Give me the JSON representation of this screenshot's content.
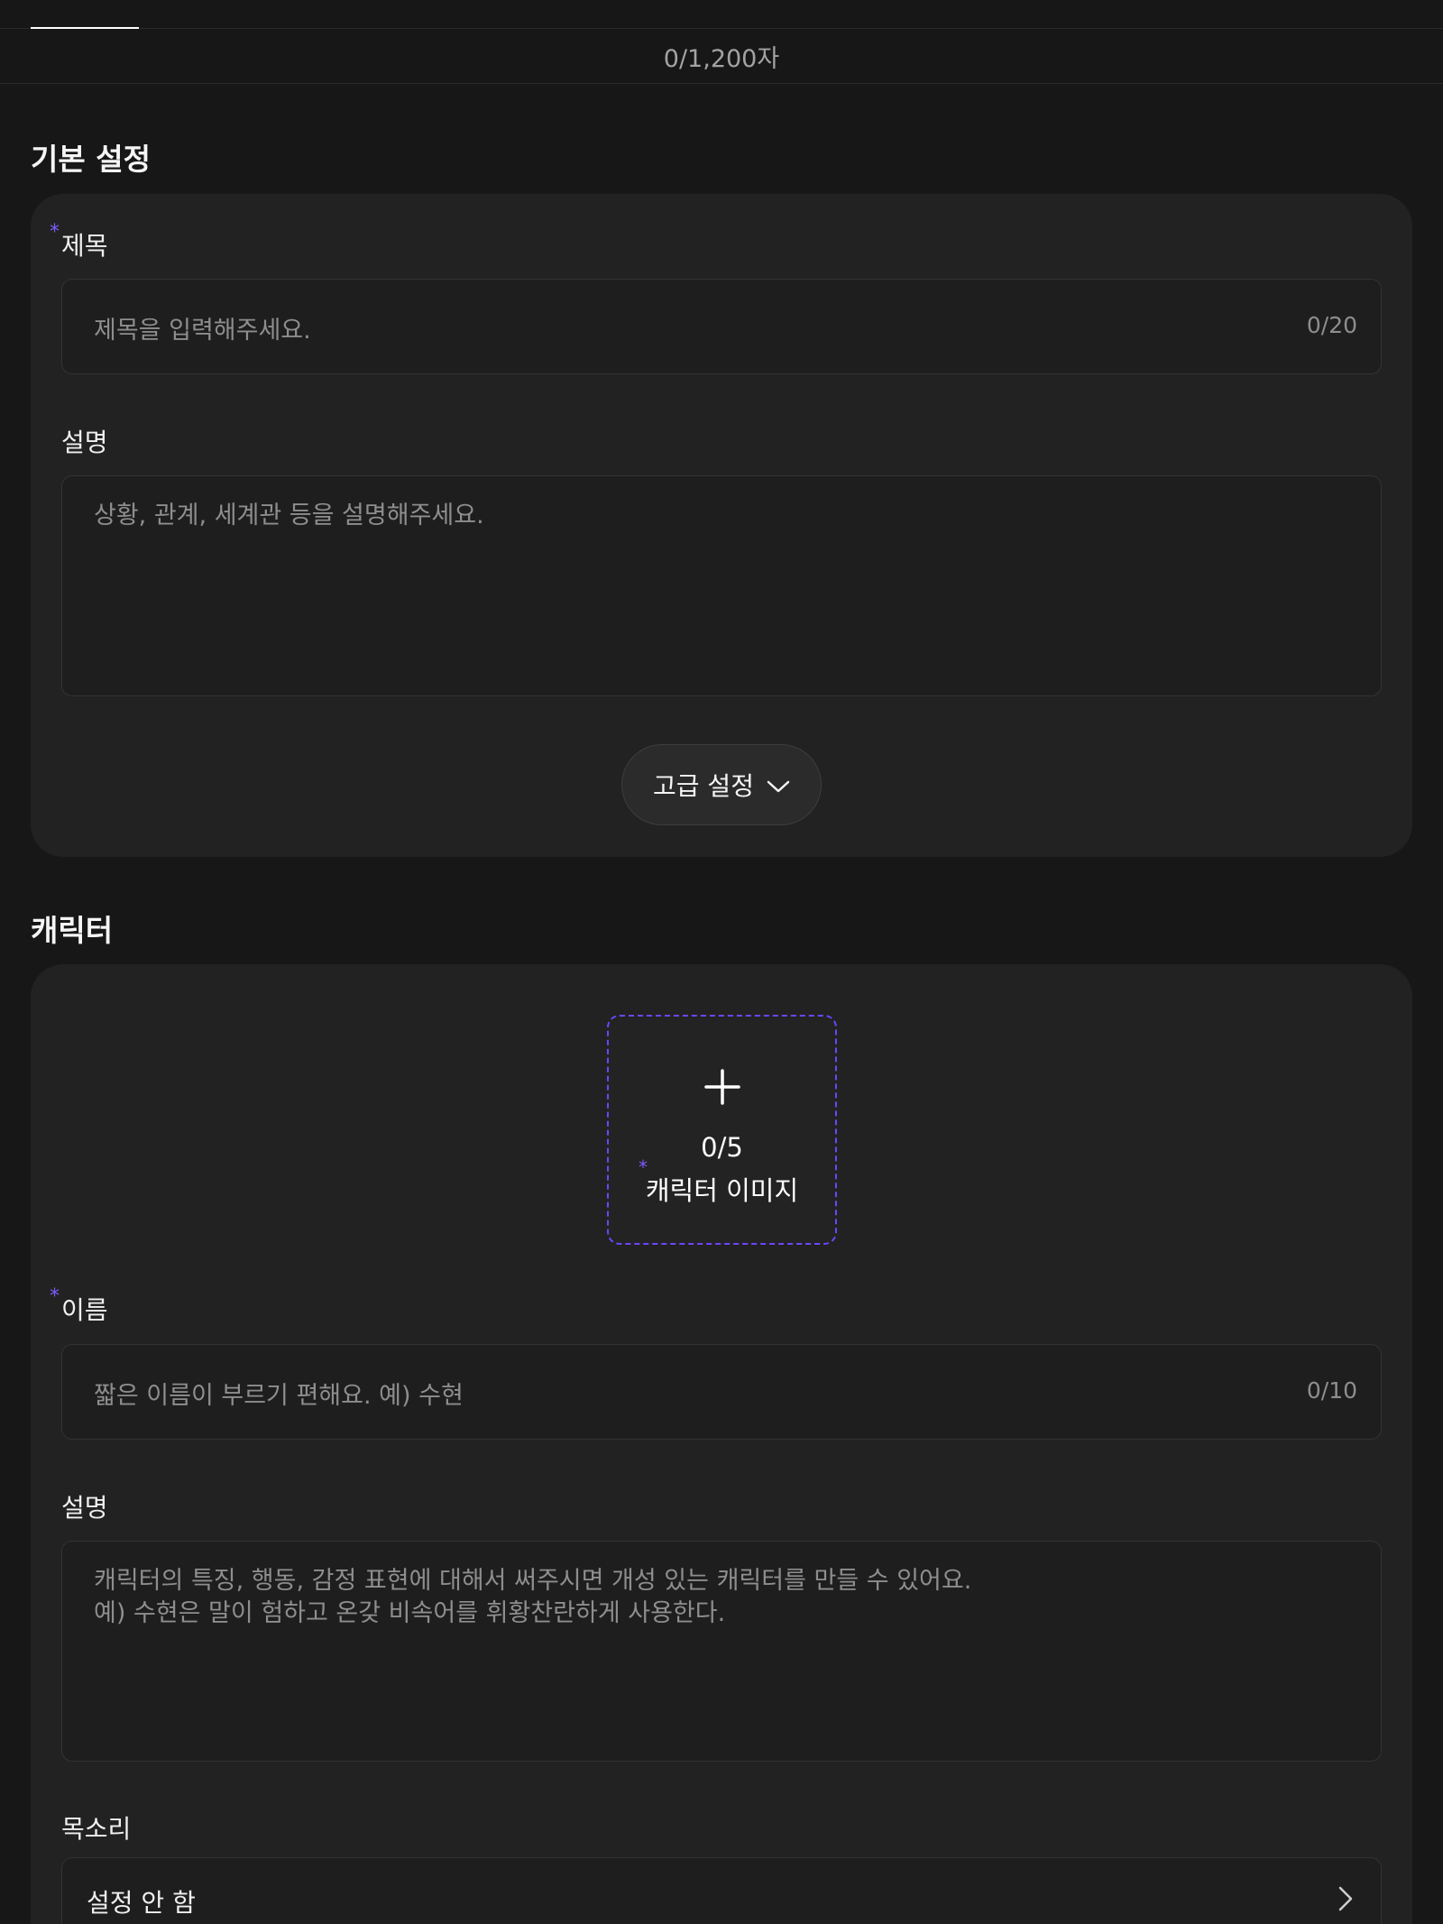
{
  "counter_bar": {
    "text": "0/1,200자"
  },
  "basic_section": {
    "title": "기본 설정",
    "title_field": {
      "required_mark": "*",
      "label": "제목",
      "placeholder": "제목을 입력해주세요.",
      "counter": "0/20"
    },
    "description_field": {
      "label": "설명",
      "placeholder": "상황, 관계, 세계관 등을 설명해주세요."
    },
    "advanced_button": {
      "label": "고급 설정",
      "icon": "chevron-down-icon"
    }
  },
  "character_section": {
    "title": "캐릭터",
    "image_upload": {
      "icon": "plus-icon",
      "count": "0/5",
      "required_mark": "*",
      "label": "캐릭터 이미지"
    },
    "name_field": {
      "required_mark": "*",
      "label": "이름",
      "placeholder": "짧은 이름이 부르기 편해요. 예) 수현",
      "counter": "0/10"
    },
    "description_field": {
      "label": "설명",
      "placeholder": "캐릭터의 특징, 행동, 감정 표현에 대해서 써주시면 개성 있는 캐릭터를 만들 수 있어요.\n예) 수현은 말이 험하고 온갖 비속어를 휘황찬란하게 사용한다."
    },
    "voice_field": {
      "label": "목소리",
      "value": "설정 안 함",
      "icon": "chevron-right-icon"
    }
  },
  "colors": {
    "background": "#171717",
    "card": "#222222",
    "accent": "#6b46ff"
  }
}
